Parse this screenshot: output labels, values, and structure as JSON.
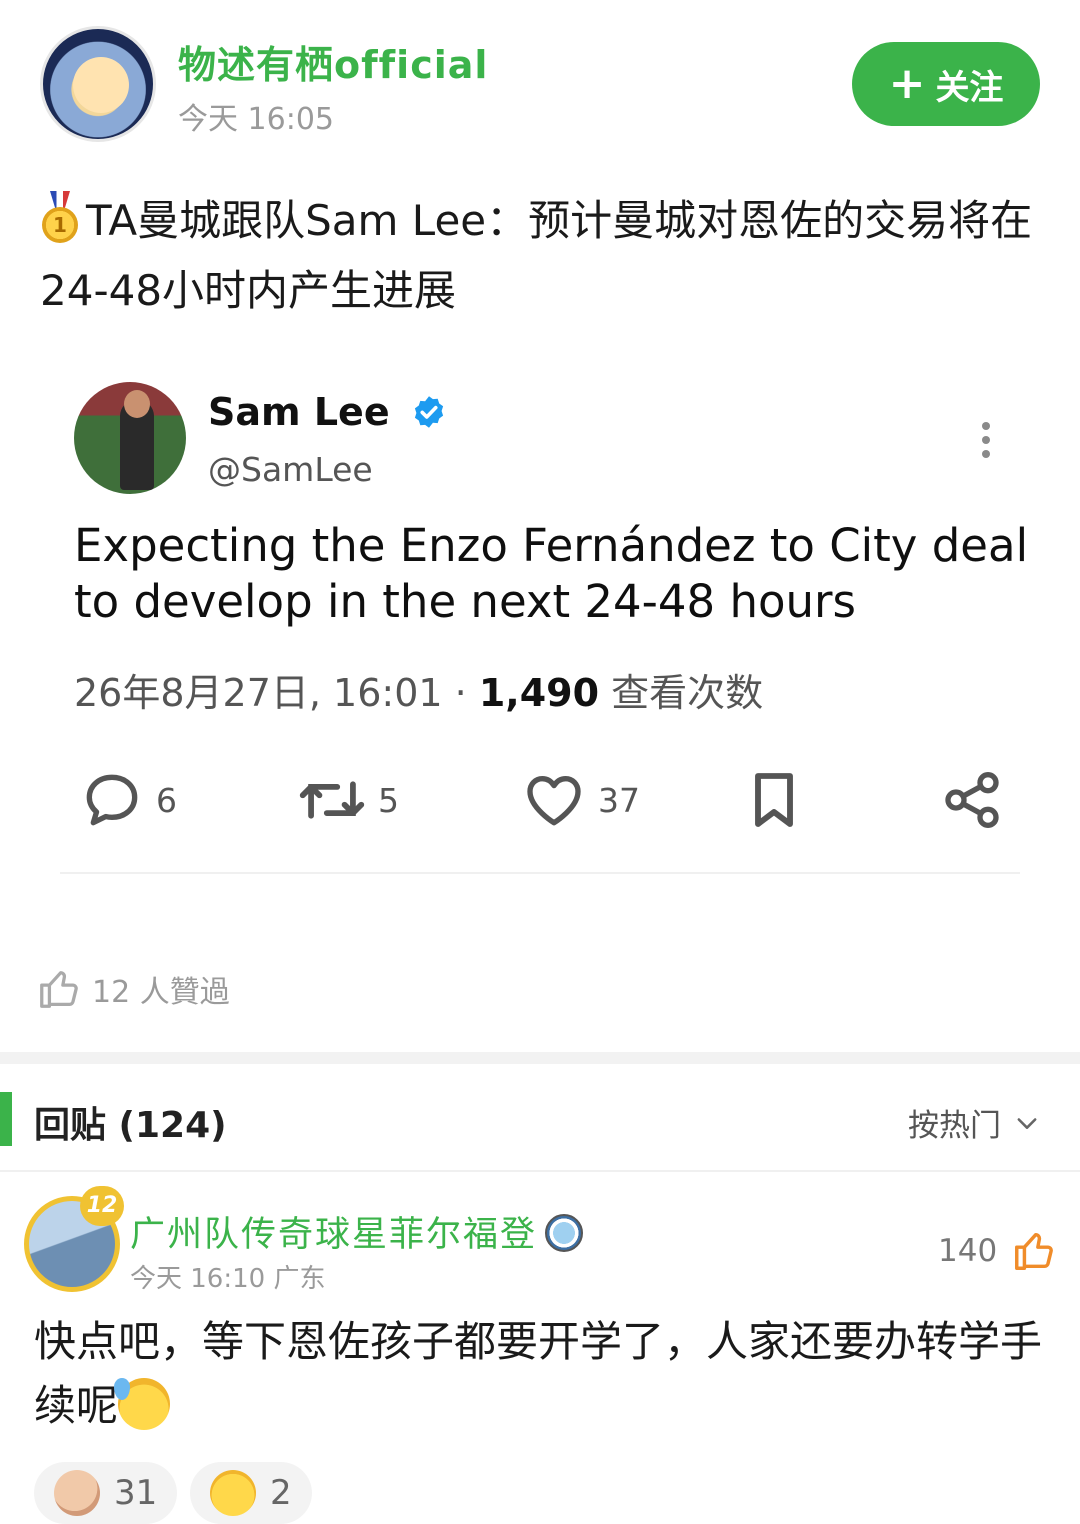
{
  "header": {
    "author_name": "物述有栖official",
    "post_time": "今天 16:05",
    "follow_label": "关注",
    "follow_icon": "plus-icon"
  },
  "post": {
    "title": "TA曼城跟队Sam Lee：预计曼城对恩佐的交易将在24-48小时内产生进展",
    "medal_number": "1"
  },
  "tweet": {
    "name": "Sam Lee",
    "handle": "@SamLee",
    "text": "Expecting the Enzo Fernández to City deal to develop in the next 24-48 hours",
    "date": "26年8月27日, 16:01",
    "separator": "·",
    "views_count": "1,490",
    "views_label": "查看次数",
    "replies": "6",
    "retweets": "5",
    "likes": "37",
    "colors": {
      "verified": "#1d9bf0"
    }
  },
  "likes_summary": "12 人贊過",
  "replies_section": {
    "title": "回贴 (124)",
    "sort_label": "按热门"
  },
  "comment": {
    "level": "12",
    "name": "广州队传奇球星菲尔福登",
    "time": "今天 16:10 广东",
    "like_count": "140",
    "text": "快点吧，等下恩佐孩子都要开学了，人家还要办转学手续呢",
    "reactions": [
      {
        "icon": "bald-face-icon",
        "count": "31"
      },
      {
        "icon": "laughing-face-icon",
        "count": "2"
      }
    ]
  },
  "colors": {
    "accent": "#3bb34a",
    "like_orange": "#f08c2a"
  }
}
